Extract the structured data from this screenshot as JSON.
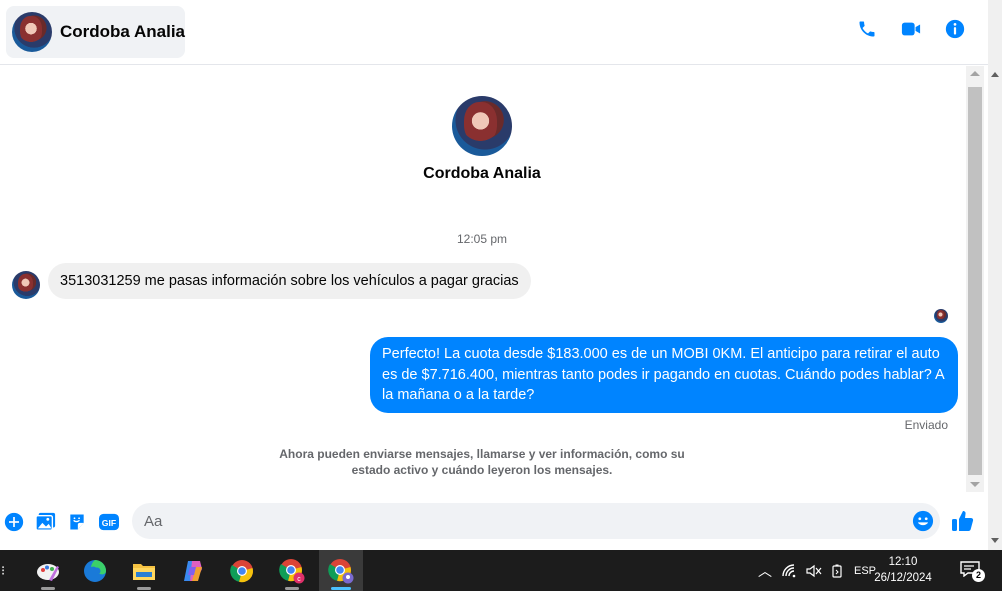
{
  "header": {
    "contact_name": "Cordoba Analia",
    "icons": [
      "phone-icon",
      "video-camera-icon",
      "info-icon"
    ],
    "accent_color": "#0084ff"
  },
  "conversation": {
    "profile_name": "Cordoba Analia",
    "timestamp": "12:05 pm",
    "incoming_message": "3513031259 me pasas información sobre los vehículos a pagar gracias",
    "outgoing_message": "Perfecto! La cuota desde $183.000 es de un MOBI 0KM. El anticipo para retirar el auto es de $7.716.400, mientras tanto podes ir pagando en cuotas. Cuándo podes hablar? A la mañana o a la tarde?",
    "sent_status": "Enviado",
    "notice": "Ahora pueden enviarse mensajes, llamarse y ver información, como su estado activo y cuándo leyeron los mensajes."
  },
  "composer": {
    "placeholder": "Aa",
    "icons": [
      "add-icon",
      "photo-icon",
      "sticker-icon",
      "gif-icon",
      "emoji-icon",
      "thumbs-up-icon"
    ],
    "gif_label": "GIF"
  },
  "taskbar": {
    "apps": [
      "paint-app-icon",
      "edge-icon",
      "file-explorer-icon",
      "copilot-icon",
      "chrome-icon",
      "chrome-profile-icon",
      "chrome-profile-2-icon"
    ],
    "language": "ESP",
    "time": "12:10",
    "date": "26/12/2024",
    "notification_count": "2"
  }
}
